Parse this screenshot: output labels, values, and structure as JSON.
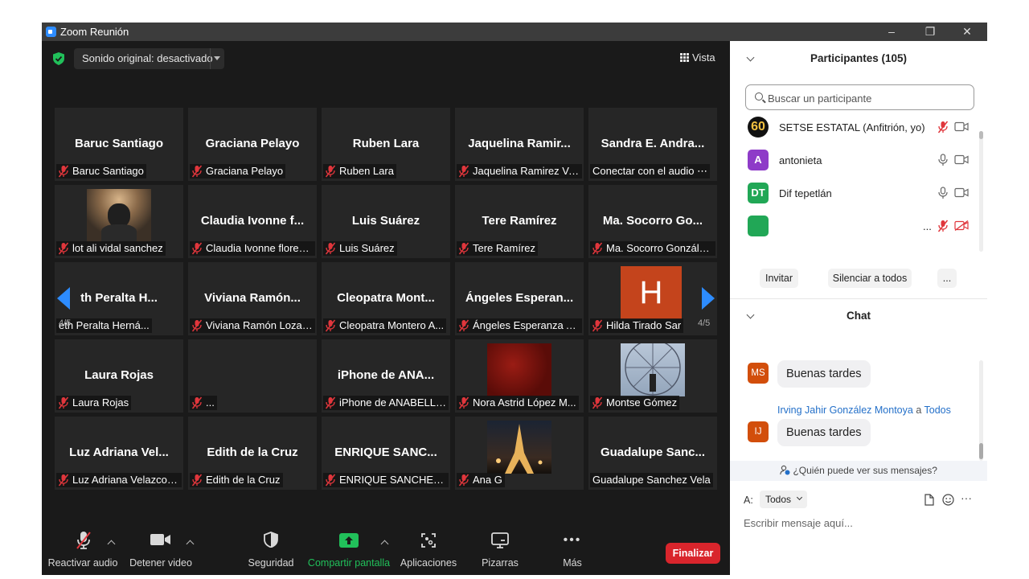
{
  "window": {
    "title": "Zoom Reunión",
    "controls": {
      "minimize": "–",
      "maximize": "❐",
      "close": "✕"
    }
  },
  "video_area": {
    "audio_mode": "Sonido original: desactivado",
    "view_label": "Vista",
    "page_indicator": "4/5",
    "participant_tiles": [
      {
        "big_name": "Baruc Santiago",
        "label": "Baruc Santiago",
        "muted": true
      },
      {
        "big_name": "Graciana Pelayo",
        "label": "Graciana Pelayo",
        "muted": true
      },
      {
        "big_name": "Ruben Lara",
        "label": "Ruben Lara",
        "muted": true
      },
      {
        "big_name": "Jaquelina Ramir...",
        "label": "Jaquelina Ramirez Va...",
        "muted": true
      },
      {
        "big_name": "Sandra E. Andra...",
        "label": "Conectar con el audio ⋯",
        "muted": false
      },
      {
        "big_name": "",
        "label": "lot ali vidal sanchez",
        "muted": true,
        "photo": "person-photo"
      },
      {
        "big_name": "Claudia Ivonne f...",
        "label": "Claudia Ivonne flores ...",
        "muted": true
      },
      {
        "big_name": "Luis Suárez",
        "label": "Luis Suárez",
        "muted": true
      },
      {
        "big_name": "Tere Ramírez",
        "label": "Tere Ramírez",
        "muted": true
      },
      {
        "big_name": "Ma. Socorro Go...",
        "label": "Ma. Socorro Gonzále...",
        "muted": true
      },
      {
        "big_name": "th Peralta H...",
        "label": "eth Peralta Herná...",
        "muted": false
      },
      {
        "big_name": "Viviana Ramón...",
        "label": "Viviana Ramón Lozada",
        "muted": true
      },
      {
        "big_name": "Cleopatra Mont...",
        "label": "Cleopatra Montero A...",
        "muted": true
      },
      {
        "big_name": "Ángeles Esperan...",
        "label": "Ángeles Esperanza A...",
        "muted": true
      },
      {
        "big_name": "",
        "label": "Hilda Tirado Sar",
        "muted": true,
        "avatar_letter": "H"
      },
      {
        "big_name": "Laura Rojas",
        "label": "Laura Rojas",
        "muted": true
      },
      {
        "big_name": "",
        "label": "...",
        "muted": true
      },
      {
        "big_name": "iPhone de ANA...",
        "label": "iPhone de ANABELLE ...",
        "muted": true
      },
      {
        "big_name": "",
        "label": "Nora Astrid López M...",
        "muted": true,
        "photo": "red-photo"
      },
      {
        "big_name": "",
        "label": "Montse Gómez",
        "muted": true,
        "photo": "ferris-wheel-photo"
      },
      {
        "big_name": "Luz Adriana Vel...",
        "label": "Luz Adriana Velazco F...",
        "muted": true
      },
      {
        "big_name": "Edith de la Cruz",
        "label": "Edith de la Cruz",
        "muted": true
      },
      {
        "big_name": "ENRIQUE SANC...",
        "label": "ENRIQUE SANCHEZ ...",
        "muted": true
      },
      {
        "big_name": "",
        "label": "Ana G",
        "muted": true,
        "photo": "eiffel-tower-photo"
      },
      {
        "big_name": "Guadalupe Sanc...",
        "label": "Guadalupe Sanchez Vela",
        "muted": false
      }
    ]
  },
  "toolbar": {
    "unmute": "Reactivar audio",
    "stop_video": "Detener video",
    "security": "Seguridad",
    "share_screen": "Compartir pantalla",
    "apps": "Aplicaciones",
    "whiteboards": "Pizarras",
    "more": "Más",
    "more_glyph": "•••",
    "end": "Finalizar"
  },
  "participants_panel": {
    "title": "Participantes (105)",
    "search_placeholder": "Buscar un participante",
    "list": [
      {
        "initials": "60",
        "name": "SETSE ESTATAL (Anfitrión, yo)",
        "avatar_color": "#111111",
        "mic": "muted",
        "cam": "on"
      },
      {
        "initials": "A",
        "name": "antonieta",
        "avatar_color": "#8e3bc8",
        "mic": "on",
        "cam": "on"
      },
      {
        "initials": "DT",
        "name": "Dif tepetlán",
        "avatar_color": "#21a756",
        "mic": "on",
        "cam": "on"
      },
      {
        "initials": "",
        "name": "...",
        "avatar_color": "#21a756",
        "mic": "muted",
        "cam": "off"
      }
    ],
    "invite": "Invitar",
    "mute_all": "Silenciar a todos",
    "more": "..."
  },
  "chat_panel": {
    "title": "Chat",
    "messages": [
      {
        "initials": "MS",
        "sender": "",
        "text": "Buenas tardes"
      },
      {
        "initials": "IJ",
        "sender": "Irving Jahir González Montoya",
        "to_word": "a",
        "to": "Todos",
        "text": "Buenas tardes"
      }
    ],
    "privacy_note": "¿Quién puede ver sus mensajes?",
    "to_label": "A:",
    "to_value": "Todos",
    "more": "···",
    "input_placeholder": "Escribir mensaje aquí..."
  },
  "colors": {
    "accent_green": "#21c05a",
    "end_red": "#d9252c",
    "muted_red": "#e0363c",
    "link_blue": "#2470c9",
    "page_arrow_blue": "#2d8cff"
  }
}
